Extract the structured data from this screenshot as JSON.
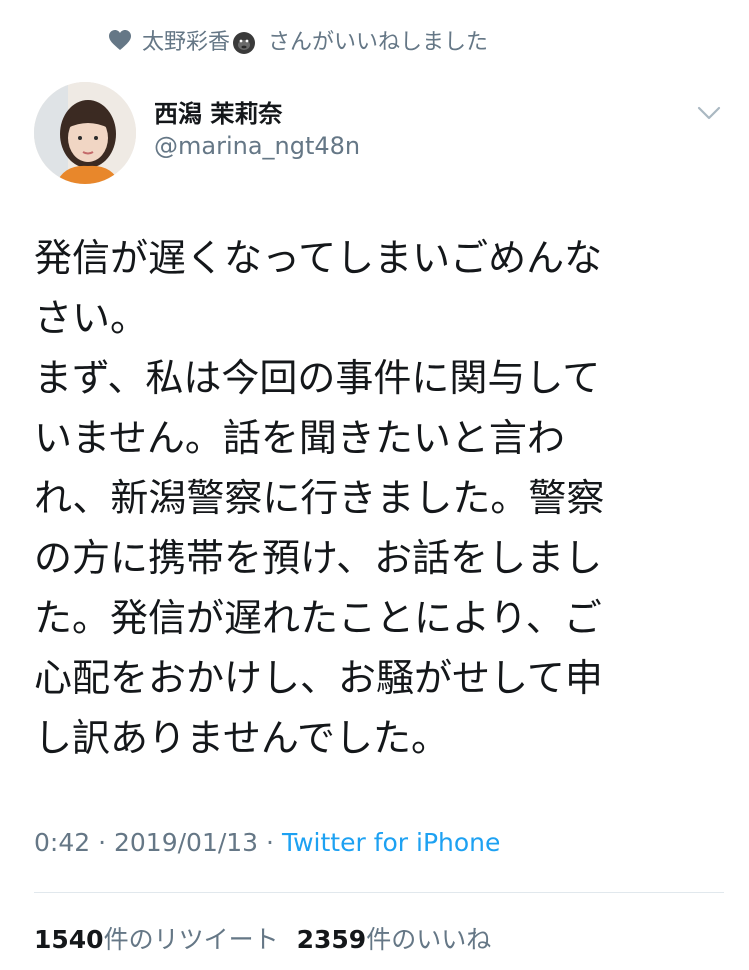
{
  "social_context": {
    "icon": "heart-icon",
    "liker_name": "太野彩香",
    "liker_emoji": "gorilla-emoji",
    "suffix": "さんがいいねしました"
  },
  "author": {
    "display_name": "西潟 茉莉奈",
    "handle": "@marina_ngt48n",
    "avatar": "profile-photo"
  },
  "tweet": {
    "lines": [
      "発信が遅くなってしまいごめんな",
      "さい。",
      "まず、私は今回の事件に関与して",
      "いません。話を聞きたいと言わ",
      "れ、新潟警察に行きました。警察",
      "の方に携帯を預け、お話をしまし",
      "た。発信が遅れたことにより、ご",
      "心配をおかけし、お騒がせして申",
      "し訳ありませんでした。"
    ]
  },
  "meta": {
    "time": "0:42",
    "separator": "·",
    "date": "2019/01/13",
    "source": "Twitter for iPhone"
  },
  "stats": {
    "retweets": "1540",
    "retweets_label": "件のリツイート",
    "likes": "2359",
    "likes_label": "件のいいね"
  },
  "colors": {
    "text": "#14171a",
    "secondary": "#657786",
    "link": "#1da1f2",
    "divider": "#e1e8ed"
  }
}
